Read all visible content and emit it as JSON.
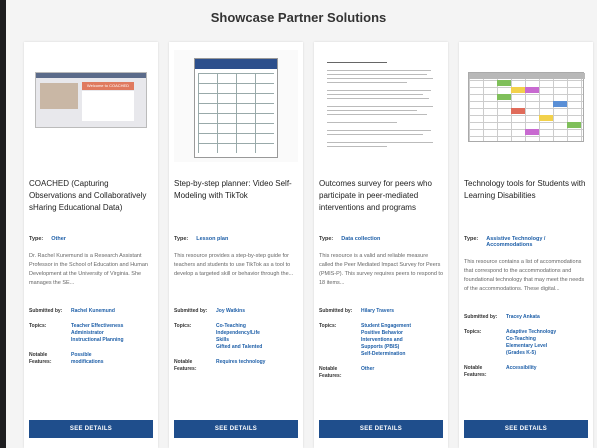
{
  "section": {
    "title": "Showcase Partner Solutions"
  },
  "labels": {
    "type": "Type:",
    "submitted_by": "Submitted by:",
    "topics": "Topics:",
    "notable_features": "Notable Features:",
    "button": "SEE DETAILS"
  },
  "thumbnails": {
    "card1_banner": "Welcome to COACHED"
  },
  "cards": [
    {
      "title": "COACHED (Capturing Observations and Collaboratively sHaring Educational Data)",
      "type": "Other",
      "description": "Dr. Rachel Kunemund is a Research Assistant Professor in the School of Education and Human Development at the University of Virginia. She manages the SE...",
      "submitted_by": "Rachel Kunemund",
      "topics": "Teacher Effectiveness\nAdministrator\nInstructional Planning",
      "notable_features": "Possible\nmodifications"
    },
    {
      "title": "Step-by-step planner: Video Self-Modeling with TikTok",
      "type": "Lesson plan",
      "description": "This resource provides a step-by-step guide for teachers and students to use TikTok as a tool to develop a targeted skill or behavior through the...",
      "submitted_by": "Joy Watkins",
      "topics": "Co-Teaching\nIndependency/Life\nSkills\nGifted and Talented",
      "notable_features": "Requires technology"
    },
    {
      "title": "Outcomes survey for peers who participate in peer-mediated interventions and programs",
      "type": "Data collection",
      "description": "This resource is a valid and reliable measure called the Peer Mediated Impact Survey for Peers (PMIS-P). This survey requires peers to respond to 18 items...",
      "submitted_by": "Hilary Travers",
      "topics": "Student Engagement\nPositive Behavior\nInterventions and\nSupports (PBIS)\nSelf-Determination",
      "notable_features": "Other"
    },
    {
      "title": "Technology tools for Students with Learning Disabilities",
      "type": "Assistive Technology / Accommodations",
      "description": "This resource contains a list of accommodations that correspond to the accommodations and foundational technology that may meet the needs of the accommodations. These digital...",
      "submitted_by": "Tracey Ankata",
      "topics": "Adaptive Technology\nCo-Teaching\nElementary Level\n(Grades K-5)",
      "notable_features": "Accessibility"
    }
  ],
  "colors": {
    "button": "#1f4e8c",
    "link": "#1e5fa8",
    "accent": "#e07a5f"
  },
  "icons": {
    "left_edge": "dark-sidebar-strip"
  }
}
